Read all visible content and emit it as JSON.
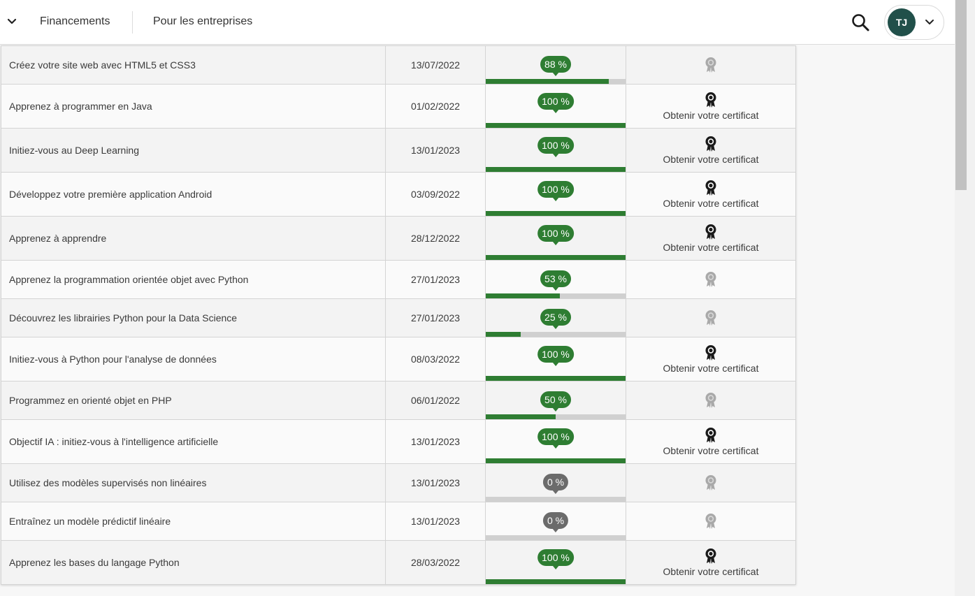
{
  "nav": {
    "items": [
      "Financements",
      "Pour les entreprises"
    ],
    "user_initials": "TJ"
  },
  "colors": {
    "accent": "#2e7d32",
    "avatar": "#21504a",
    "badge_zero": "#6b6b6b"
  },
  "table": {
    "rows": [
      {
        "title": "Créez votre site web avec HTML5 et CSS3",
        "date": "13/07/2022",
        "progress": 88,
        "progress_label": "88 %",
        "certificate": null,
        "medal": "medal-gray-icon"
      },
      {
        "title": "Apprenez à programmer en Java",
        "date": "01/02/2022",
        "progress": 100,
        "progress_label": "100 %",
        "certificate": "Obtenir votre certificat",
        "medal": "medal-black-icon"
      },
      {
        "title": "Initiez-vous au Deep Learning",
        "date": "13/01/2023",
        "progress": 100,
        "progress_label": "100 %",
        "certificate": "Obtenir votre certificat",
        "medal": "medal-black-icon"
      },
      {
        "title": "Développez votre première application Android",
        "date": "03/09/2022",
        "progress": 100,
        "progress_label": "100 %",
        "certificate": "Obtenir votre certificat",
        "medal": "medal-black-icon"
      },
      {
        "title": "Apprenez à apprendre",
        "date": "28/12/2022",
        "progress": 100,
        "progress_label": "100 %",
        "certificate": "Obtenir votre certificat",
        "medal": "medal-black-icon"
      },
      {
        "title": "Apprenez la programmation orientée objet avec Python",
        "date": "27/01/2023",
        "progress": 53,
        "progress_label": "53 %",
        "certificate": null,
        "medal": "medal-gray-icon"
      },
      {
        "title": "Découvrez les librairies Python pour la Data Science",
        "date": "27/01/2023",
        "progress": 25,
        "progress_label": "25 %",
        "certificate": null,
        "medal": "medal-gray-icon"
      },
      {
        "title": "Initiez-vous à Python pour l'analyse de données",
        "date": "08/03/2022",
        "progress": 100,
        "progress_label": "100 %",
        "certificate": "Obtenir votre certificat",
        "medal": "medal-black-icon"
      },
      {
        "title": "Programmez en orienté objet en PHP",
        "date": "06/01/2022",
        "progress": 50,
        "progress_label": "50 %",
        "certificate": null,
        "medal": "medal-gray-icon"
      },
      {
        "title": "Objectif IA : initiez-vous à l'intelligence artificielle",
        "date": "13/01/2023",
        "progress": 100,
        "progress_label": "100 %",
        "certificate": "Obtenir votre certificat",
        "medal": "medal-black-icon"
      },
      {
        "title": "Utilisez des modèles supervisés non linéaires",
        "date": "13/01/2023",
        "progress": 0,
        "progress_label": "0 %",
        "certificate": null,
        "medal": "medal-gray-icon"
      },
      {
        "title": "Entraînez un modèle prédictif linéaire",
        "date": "13/01/2023",
        "progress": 0,
        "progress_label": "0 %",
        "certificate": null,
        "medal": "medal-gray-icon"
      },
      {
        "title": "Apprenez les bases du langage Python",
        "date": "28/03/2022",
        "progress": 100,
        "progress_label": "100 %",
        "certificate": "Obtenir votre certificat",
        "medal": "medal-black-icon"
      }
    ]
  }
}
